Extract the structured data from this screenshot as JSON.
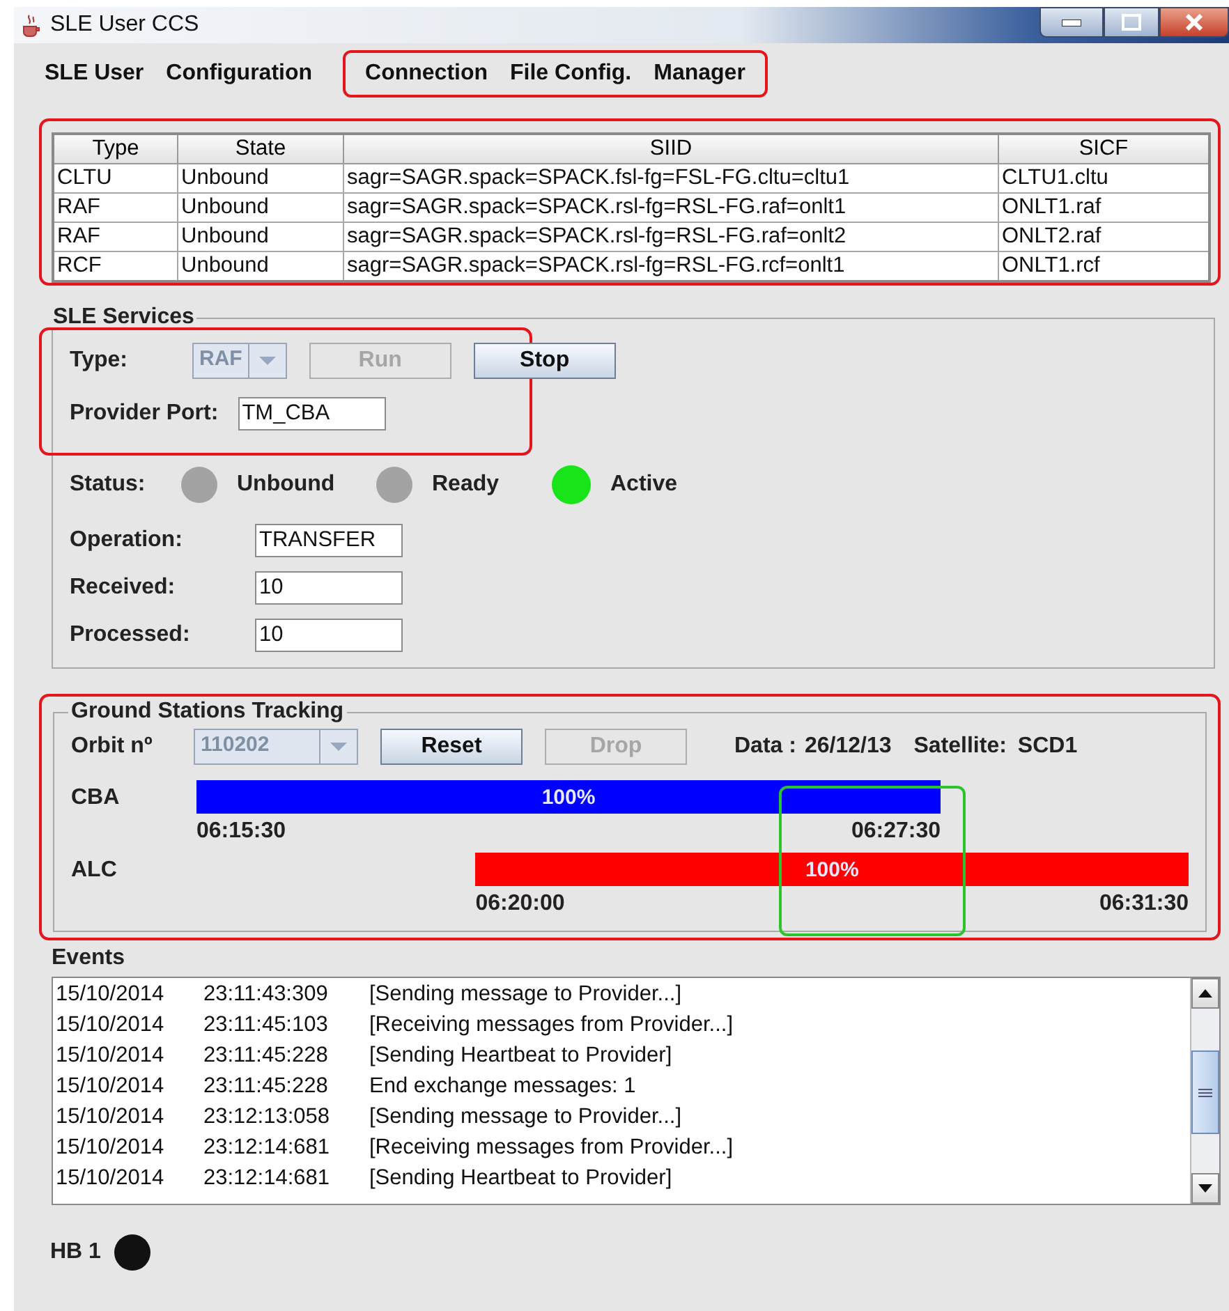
{
  "window": {
    "title": "SLE User CCS"
  },
  "menu": {
    "groups": [
      {
        "items": [
          "SLE User",
          "Configuration"
        ],
        "highlighted": false
      },
      {
        "items": [
          "Connection",
          "File Config.",
          "Manager"
        ],
        "highlighted": true
      }
    ]
  },
  "services_table": {
    "highlighted": true,
    "columns": [
      "Type",
      "State",
      "SIID",
      "SICF"
    ],
    "rows": [
      [
        "CLTU",
        "Unbound",
        "sagr=SAGR.spack=SPACK.fsl-fg=FSL-FG.cltu=cltu1",
        "CLTU1.cltu"
      ],
      [
        "RAF",
        "Unbound",
        "sagr=SAGR.spack=SPACK.rsl-fg=RSL-FG.raf=onlt1",
        "ONLT1.raf"
      ],
      [
        "RAF",
        "Unbound",
        "sagr=SAGR.spack=SPACK.rsl-fg=RSL-FG.raf=onlt2",
        "ONLT2.raf"
      ],
      [
        "RCF",
        "Unbound",
        "sagr=SAGR.spack=SPACK.rsl-fg=RSL-FG.rcf=onlt1",
        "ONLT1.rcf"
      ]
    ]
  },
  "sle_services": {
    "title": "SLE Services",
    "config_highlighted": true,
    "type": {
      "label": "Type:",
      "value": "RAF",
      "disabled": true
    },
    "buttons": [
      {
        "label": "Run",
        "disabled": true
      },
      {
        "label": "Stop",
        "disabled": false
      }
    ],
    "provider_port": {
      "label": "Provider Port:",
      "value": "TM_CBA"
    },
    "status": {
      "label": "Status:",
      "lights": [
        {
          "label": "Unbound",
          "color": "#a3a3a3"
        },
        {
          "label": "Ready",
          "color": "#a3a3a3"
        },
        {
          "label": "Active",
          "color": "#19e319"
        }
      ]
    },
    "fields": [
      {
        "label": "Operation:",
        "value": "TRANSFER"
      },
      {
        "label": "Received:",
        "value": "10"
      },
      {
        "label": "Processed:",
        "value": "10"
      }
    ]
  },
  "tracking": {
    "title": "Ground Stations Tracking",
    "highlighted": true,
    "end_time_focus": true,
    "orbit": {
      "label": "Orbit nº",
      "value": "110202",
      "disabled": true
    },
    "buttons": [
      {
        "label": "Reset",
        "disabled": false
      },
      {
        "label": "Drop",
        "disabled": true
      }
    ],
    "date_label": "Data :",
    "date": "26/12/13",
    "satellite_label": "Satellite:",
    "satellite": "SCD1",
    "stations": [
      {
        "name": "CBA",
        "start": "06:15:30",
        "end": "06:27:30",
        "reading": "100%",
        "color": "#0000ff"
      },
      {
        "name": "ALC",
        "start": "06:20:00",
        "end": "06:31:30",
        "reading": "100%",
        "color": "#ff0000"
      }
    ]
  },
  "events": {
    "title": "Events",
    "rows": [
      {
        "date": "15/10/2014",
        "time": "23:11:43:309",
        "message": "[Sending message to Provider...]"
      },
      {
        "date": "15/10/2014",
        "time": "23:11:45:103",
        "message": "[Receiving messages from Provider...]"
      },
      {
        "date": "15/10/2014",
        "time": "23:11:45:228",
        "message": "[Sending Heartbeat to Provider]"
      },
      {
        "date": "15/10/2014",
        "time": "23:11:45:228",
        "message": "End exchange messages:  1"
      },
      {
        "date": "15/10/2014",
        "time": "23:12:13:058",
        "message": "[Sending message to Provider...]"
      },
      {
        "date": "15/10/2014",
        "time": "23:12:14:681",
        "message": "[Receiving messages from Provider...]"
      },
      {
        "date": "15/10/2014",
        "time": "23:12:14:681",
        "message": "[Sending Heartbeat to Provider]"
      }
    ]
  },
  "heartbeat": {
    "label": "HB 1",
    "color": "#111111"
  }
}
